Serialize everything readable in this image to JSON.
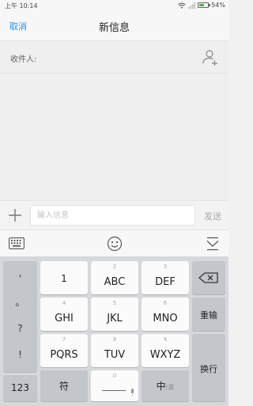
{
  "status": {
    "time": "上午 10:14",
    "battery": "54%",
    "battery_level": 0.54
  },
  "nav": {
    "cancel": "取消",
    "title": "新信息"
  },
  "recipient": {
    "label": "收件人:"
  },
  "compose": {
    "placeholder": "输入信息",
    "send": "发送"
  },
  "keyboard": {
    "punctuation": [
      ",",
      "。",
      "?",
      "!"
    ],
    "keys": [
      {
        "num": "1",
        "letters": ""
      },
      {
        "num": "2",
        "letters": "ABC"
      },
      {
        "num": "3",
        "letters": "DEF"
      },
      {
        "num": "4",
        "letters": "GHI"
      },
      {
        "num": "5",
        "letters": "JKL"
      },
      {
        "num": "6",
        "letters": "MNO"
      },
      {
        "num": "7",
        "letters": "PQRS"
      },
      {
        "num": "8",
        "letters": "TUV"
      },
      {
        "num": "9",
        "letters": "WXYZ"
      }
    ],
    "reenter": "重输",
    "newline": "换行",
    "mode_123": "123",
    "symbol": "符",
    "space_num": "0",
    "lang_zh": "中",
    "lang_en": "/英"
  },
  "icons": {
    "wifi": "wifi-icon",
    "signal": "signal-icon",
    "battery": "battery-icon",
    "add_contact": "add-contact-icon",
    "plus": "plus-icon",
    "keyboard": "keyboard-icon",
    "emoji": "smiley-icon",
    "hide_keyboard": "hide-keyboard-icon",
    "backspace": "backspace-icon",
    "mic": "mic-icon"
  },
  "colors": {
    "accent": "#2f8ee8",
    "battery": "#4caf50"
  }
}
